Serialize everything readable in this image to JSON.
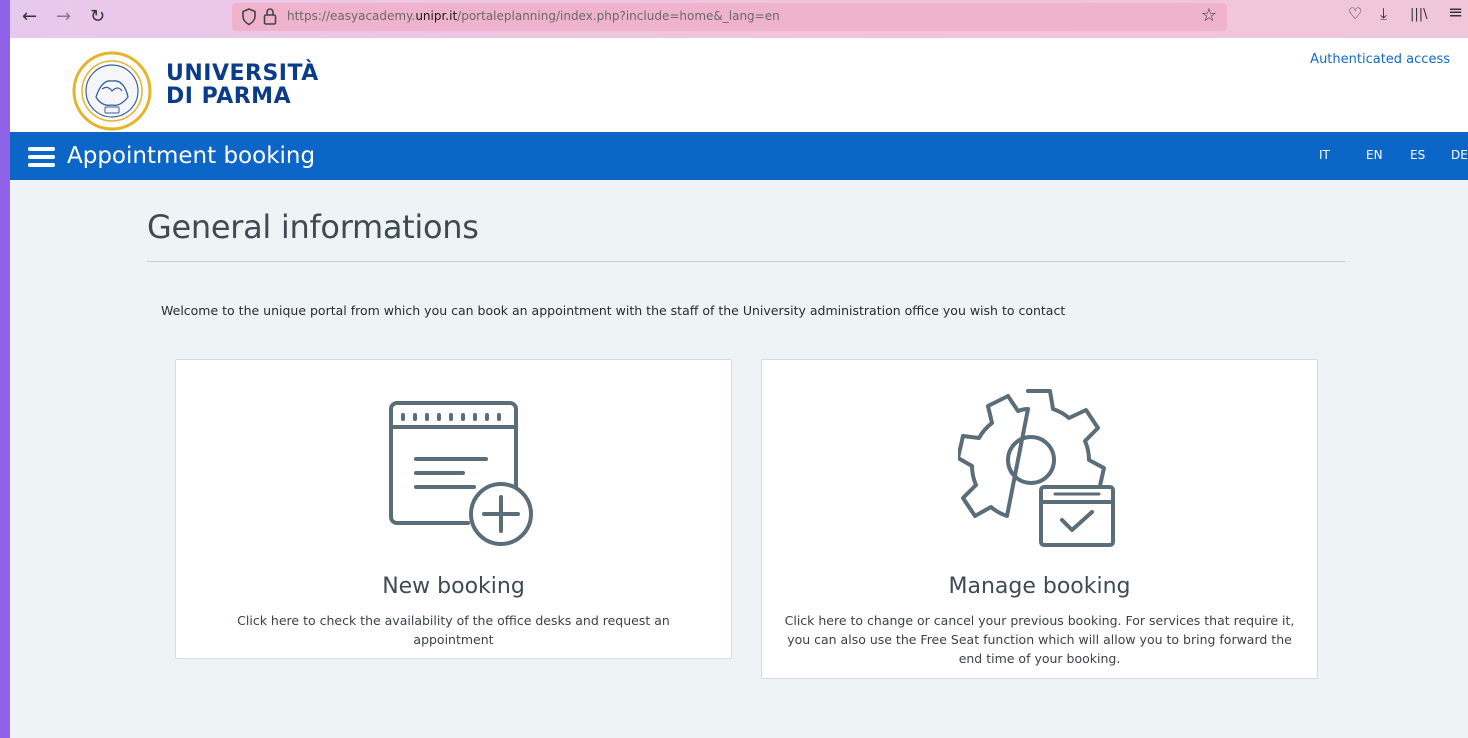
{
  "browser": {
    "back_icon": "←",
    "forward_icon": "→",
    "reload_icon": "↻",
    "url_prefix": "https://easyacademy.",
    "url_domain": "unipr.it",
    "url_suffix": "/portaleplanning/index.php?include=home&_lang=en",
    "bookmark_icon": "☆",
    "pocket_icon": "♡",
    "download_icon": "⤓",
    "library_icon": "|||\\",
    "menu_icon": "≡"
  },
  "header": {
    "university_line1": "UNIVERSITÀ",
    "university_line2": "DI PARMA",
    "auth_link": "Authenticated access"
  },
  "app_bar": {
    "title": "Appointment booking",
    "languages": [
      "IT",
      "EN",
      "ES",
      "DE"
    ]
  },
  "main": {
    "title": "General informations",
    "welcome": "Welcome to the unique portal from which you can book an appointment with the staff of the University administration office you wish to contact",
    "cards": [
      {
        "title": "New booking",
        "description": "Click here to check the availability of the office desks and request an appointment",
        "icon": "calendar-plus-icon"
      },
      {
        "title": "Manage booking",
        "description": "Click here to change or cancel your previous booking. For services that require it, you can also use the Free Seat function which will allow you to bring forward the end time of your booking.",
        "icon": "gear-calendar-check-icon"
      }
    ]
  },
  "colors": {
    "app_bar": "#0b66c8",
    "link": "#1469c7",
    "icon_stroke": "#5b6d78",
    "brand": "#0a3c8a"
  }
}
